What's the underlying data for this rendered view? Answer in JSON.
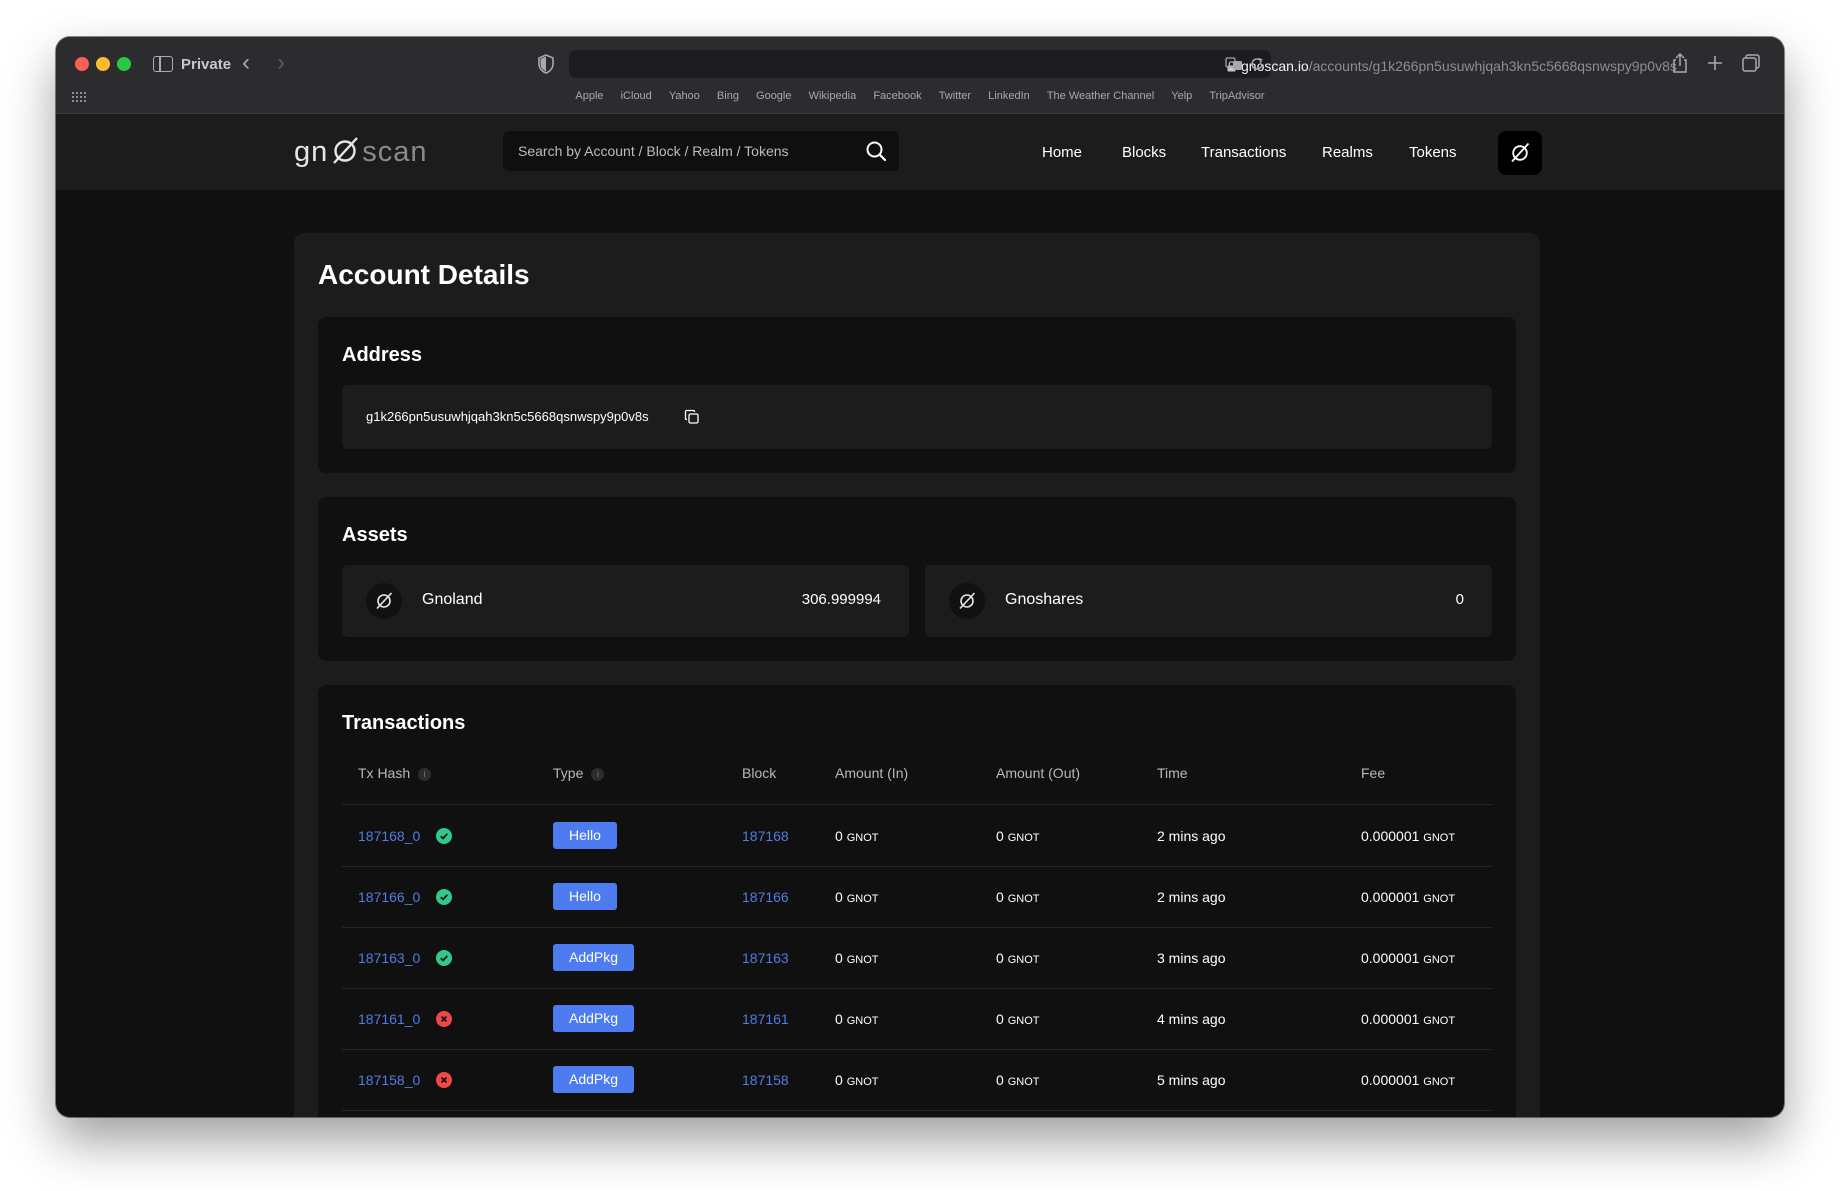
{
  "browser": {
    "private_label": "Private",
    "url_host": "gnoscan.io",
    "url_path": "/accounts/g1k266pn5usuwhjqah3kn5c5668qsnwspy9p0v8s",
    "bookmarks": [
      "Apple",
      "iCloud",
      "Yahoo",
      "Bing",
      "Google",
      "Wikipedia",
      "Facebook",
      "Twitter",
      "LinkedIn",
      "The Weather Channel",
      "Yelp",
      "TripAdvisor"
    ]
  },
  "header": {
    "logo_left": "gn",
    "logo_right": "scan",
    "search_placeholder": "Search by Account / Block / Realm / Tokens",
    "nav": [
      "Home",
      "Blocks",
      "Transactions",
      "Realms",
      "Tokens"
    ]
  },
  "page": {
    "title": "Account Details",
    "address_section": {
      "title": "Address",
      "value": "g1k266pn5usuwhjqah3kn5c5668qsnwspy9p0v8s"
    },
    "assets_section": {
      "title": "Assets",
      "assets": [
        {
          "name": "Gnoland",
          "amount": "306.999994"
        },
        {
          "name": "Gnoshares",
          "amount": "0"
        }
      ]
    },
    "transactions_section": {
      "title": "Transactions",
      "columns": [
        "Tx Hash",
        "Type",
        "Block",
        "Amount (In)",
        "Amount (Out)",
        "Time",
        "Fee"
      ],
      "rows": [
        {
          "hash": "187168_0",
          "status": "success",
          "type": "Hello",
          "block": "187168",
          "amount_in": "0",
          "amount_in_unit": "GNOT",
          "amount_out": "0",
          "amount_out_unit": "GNOT",
          "time": "2 mins ago",
          "fee": "0.000001",
          "fee_unit": "GNOT"
        },
        {
          "hash": "187166_0",
          "status": "success",
          "type": "Hello",
          "block": "187166",
          "amount_in": "0",
          "amount_in_unit": "GNOT",
          "amount_out": "0",
          "amount_out_unit": "GNOT",
          "time": "2 mins ago",
          "fee": "0.000001",
          "fee_unit": "GNOT"
        },
        {
          "hash": "187163_0",
          "status": "success",
          "type": "AddPkg",
          "block": "187163",
          "amount_in": "0",
          "amount_in_unit": "GNOT",
          "amount_out": "0",
          "amount_out_unit": "GNOT",
          "time": "3 mins ago",
          "fee": "0.000001",
          "fee_unit": "GNOT"
        },
        {
          "hash": "187161_0",
          "status": "failed",
          "type": "AddPkg",
          "block": "187161",
          "amount_in": "0",
          "amount_in_unit": "GNOT",
          "amount_out": "0",
          "amount_out_unit": "GNOT",
          "time": "4 mins ago",
          "fee": "0.000001",
          "fee_unit": "GNOT"
        },
        {
          "hash": "187158_0",
          "status": "failed",
          "type": "AddPkg",
          "block": "187158",
          "amount_in": "0",
          "amount_in_unit": "GNOT",
          "amount_out": "0",
          "amount_out_unit": "GNOT",
          "time": "5 mins ago",
          "fee": "0.000001",
          "fee_unit": "GNOT"
        }
      ]
    }
  }
}
